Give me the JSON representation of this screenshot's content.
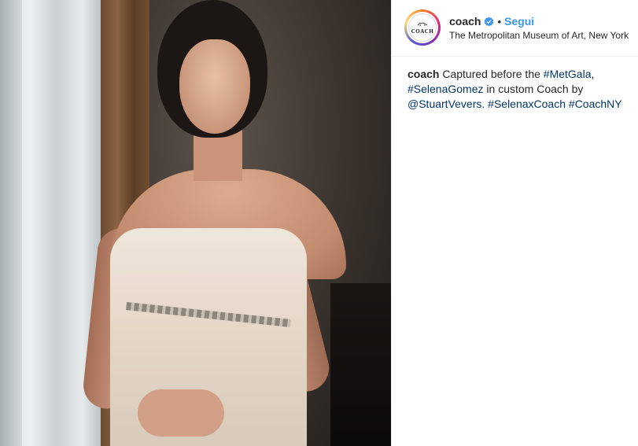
{
  "post": {
    "username": "coach",
    "follow_label": "Segui",
    "separator": "•",
    "location": "The Metropolitan Museum of Art, New York",
    "avatar": {
      "mark": "horse-carriage",
      "text": "COACH"
    },
    "verified_icon": "verified-badge-icon",
    "photo_alt": "Photo of a woman in a white beaded lace gown standing by a window"
  },
  "caption": {
    "username": "coach",
    "text_1": " Captured before the ",
    "tag_metgala": "#MetGala",
    "text_2": ", ",
    "tag_selenagomez": "#SelenaGomez",
    "text_3": " in custom Coach by ",
    "mention_stuartvevers": "@StuartVevers",
    "text_4": ". ",
    "tag_selenaxcoach": "#SelenaxCoach",
    "text_5": " ",
    "tag_coachny": "#CoachNY"
  },
  "colors": {
    "link_blue": "#3897f0",
    "hashtag": "#003569",
    "text": "#262626",
    "border": "#efefef"
  }
}
